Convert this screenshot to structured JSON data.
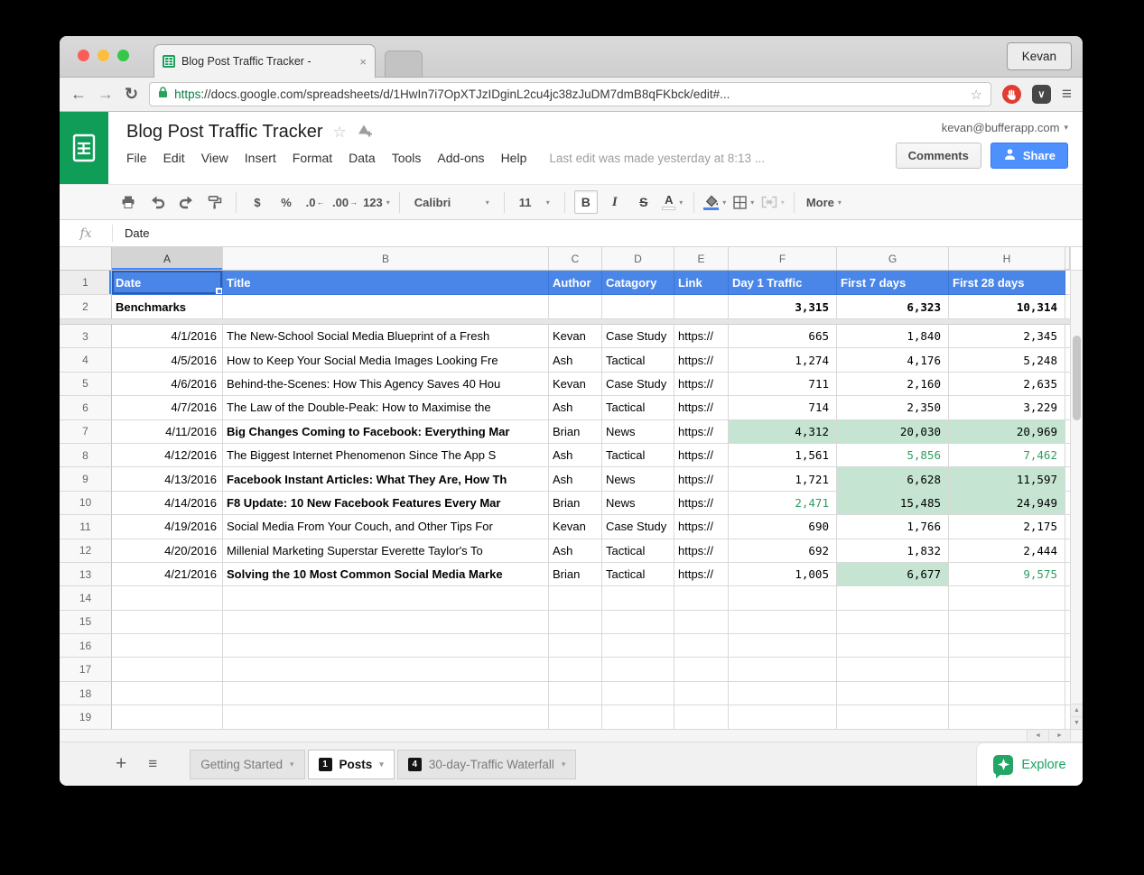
{
  "browser": {
    "tab_title": "Blog Post Traffic Tracker - ",
    "profile": "Kevan",
    "url_scheme": "https",
    "url_rest": "://docs.google.com/spreadsheets/d/1HwIn7i7OpXTJzIDginL2cu4jc38zJuDM7dmB8qFKbck/edit#..."
  },
  "icons": {
    "back": "←",
    "forward": "→",
    "refresh": "↻",
    "star": "☆",
    "menu": "≡",
    "close": "×",
    "caret": "▾",
    "pocket": "∨",
    "plus": "+",
    "all_sheets": "≡",
    "dec_left": "←",
    "dec_right": "→",
    "up": "▲",
    "down": "▼",
    "left": "◄",
    "right": "►"
  },
  "header": {
    "title": "Blog Post Traffic Tracker",
    "menus": [
      "File",
      "Edit",
      "View",
      "Insert",
      "Format",
      "Data",
      "Tools",
      "Add-ons",
      "Help"
    ],
    "last_edit": "Last edit was made yesterday at 8:13 ...",
    "comments_label": "Comments",
    "share_label": "Share",
    "account": "kevan@bufferapp.com"
  },
  "toolbar": {
    "currency": "$",
    "percent": "%",
    "dec_dec": ".0",
    "dec_inc": ".00",
    "number_format": "123",
    "font": "Calibri",
    "font_size": "11",
    "bold": "B",
    "italic": "I",
    "strike": "S",
    "text_color": "A",
    "more": "More"
  },
  "formula_bar": {
    "fx": "fx",
    "value": "Date"
  },
  "colors": {
    "header_blue": "#4a86e8",
    "green_bg": "#c5e4d2",
    "green_text": "#2f9e60",
    "logo_green": "#0f9d58"
  },
  "grid": {
    "col_letters": [
      "A",
      "B",
      "C",
      "D",
      "E",
      "F",
      "G",
      "H"
    ],
    "selected_cell": "A1",
    "header_row": {
      "n": "1",
      "date": "Date",
      "title": "Title",
      "author": "Author",
      "cat": "Catagory",
      "link": "Link",
      "f": "Day 1 Traffic",
      "g": "First 7 days",
      "h": "First 28 days"
    },
    "benchmark_row": {
      "n": "2",
      "label": "Benchmarks",
      "f": "3,315",
      "g": "6,323",
      "h": "10,314"
    },
    "rows": [
      {
        "n": "3",
        "date": "4/1/2016",
        "title": "The New-School Social Media Blueprint of a Fresh",
        "bold": false,
        "author": "Kevan",
        "cat": "Case Study",
        "link": "https://",
        "f": "665",
        "g": "1,840",
        "h": "2,345",
        "fs": "",
        "gs": "",
        "hs": ""
      },
      {
        "n": "4",
        "date": "4/5/2016",
        "title": "How to Keep Your Social Media Images Looking Fre",
        "bold": false,
        "author": "Ash",
        "cat": "Tactical",
        "link": "https://",
        "f": "1,274",
        "g": "4,176",
        "h": "5,248",
        "fs": "",
        "gs": "",
        "hs": ""
      },
      {
        "n": "5",
        "date": "4/6/2016",
        "title": "Behind-the-Scenes: How This Agency Saves 40 Hou",
        "bold": false,
        "author": "Kevan",
        "cat": "Case Study",
        "link": "https://",
        "f": "711",
        "g": "2,160",
        "h": "2,635",
        "fs": "",
        "gs": "",
        "hs": ""
      },
      {
        "n": "6",
        "date": "4/7/2016",
        "title": "The Law of the Double-Peak: How to Maximise the",
        "bold": false,
        "author": "Ash",
        "cat": "Tactical",
        "link": "https://",
        "f": "714",
        "g": "2,350",
        "h": "3,229",
        "fs": "",
        "gs": "",
        "hs": ""
      },
      {
        "n": "7",
        "date": "4/11/2016",
        "title": "Big Changes Coming to Facebook: Everything Mar",
        "bold": true,
        "author": "Brian",
        "cat": "News",
        "link": "https://",
        "f": "4,312",
        "g": "20,030",
        "h": "20,969",
        "fs": "bg",
        "gs": "bg",
        "hs": "bg"
      },
      {
        "n": "8",
        "date": "4/12/2016",
        "title": "The Biggest Internet Phenomenon Since The App S",
        "bold": false,
        "author": "Ash",
        "cat": "Tactical",
        "link": "https://",
        "f": "1,561",
        "g": "5,856",
        "h": "7,462",
        "fs": "",
        "gs": "gt",
        "hs": "gt"
      },
      {
        "n": "9",
        "date": "4/13/2016",
        "title": "Facebook Instant Articles: What They Are, How Th",
        "bold": true,
        "author": "Ash",
        "cat": "News",
        "link": "https://",
        "f": "1,721",
        "g": "6,628",
        "h": "11,597",
        "fs": "",
        "gs": "bg",
        "hs": "bg"
      },
      {
        "n": "10",
        "date": "4/14/2016",
        "title": "F8 Update: 10 New Facebook Features Every Mar",
        "bold": true,
        "author": "Brian",
        "cat": "News",
        "link": "https://",
        "f": "2,471",
        "g": "15,485",
        "h": "24,949",
        "fs": "gt",
        "gs": "bg",
        "hs": "bg"
      },
      {
        "n": "11",
        "date": "4/19/2016",
        "title": "Social Media From Your Couch, and Other Tips For",
        "bold": false,
        "author": "Kevan",
        "cat": "Case Study",
        "link": "https://",
        "f": "690",
        "g": "1,766",
        "h": "2,175",
        "fs": "",
        "gs": "",
        "hs": ""
      },
      {
        "n": "12",
        "date": "4/20/2016",
        "title": "Millenial Marketing Superstar Everette Taylor's To",
        "bold": false,
        "author": "Ash",
        "cat": "Tactical",
        "link": "https://",
        "f": "692",
        "g": "1,832",
        "h": "2,444",
        "fs": "",
        "gs": "",
        "hs": ""
      },
      {
        "n": "13",
        "date": "4/21/2016",
        "title": "Solving the 10 Most Common Social Media Marke",
        "bold": true,
        "author": "Brian",
        "cat": "Tactical",
        "link": "https://",
        "f": "1,005",
        "g": "6,677",
        "h": "9,575",
        "fs": "",
        "gs": "bg",
        "hs": "gt"
      }
    ],
    "empty_rows": [
      "14",
      "15",
      "16",
      "17",
      "18",
      "19"
    ]
  },
  "sheetbar": {
    "tabs": [
      {
        "label": "Getting Started",
        "badge": "",
        "active": false
      },
      {
        "label": "Posts",
        "badge": "1",
        "active": true
      },
      {
        "label": "30-day-Traffic Waterfall",
        "badge": "4",
        "active": false
      }
    ],
    "explore_label": "Explore"
  }
}
